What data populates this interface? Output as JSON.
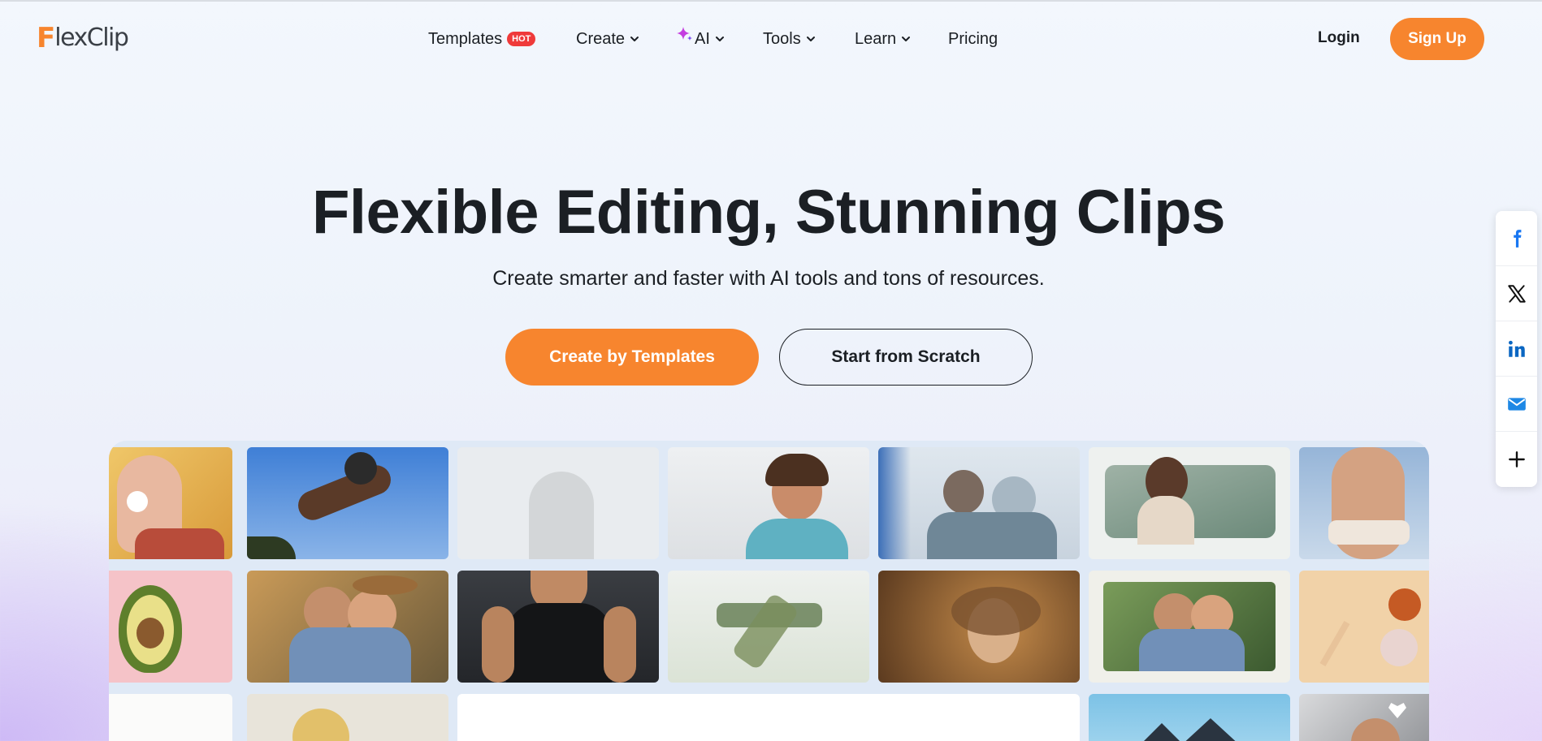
{
  "brand": {
    "logo_text": "FlexClip",
    "logo_initial": "F",
    "logo_rest": "lexClip",
    "accent": "#f7852e"
  },
  "nav": {
    "templates": {
      "label": "Templates",
      "badge": "HOT"
    },
    "create": "Create",
    "ai": "AI",
    "tools": "Tools",
    "learn": "Learn",
    "pricing": "Pricing"
  },
  "auth": {
    "login": "Login",
    "signup": "Sign Up"
  },
  "hero": {
    "title": "Flexible Editing, Stunning Clips",
    "subtitle": "Create smarter and faster with AI tools and tons of resources.",
    "primary_cta": "Create by Templates",
    "secondary_cta": "Start from Scratch"
  },
  "share": {
    "icons": [
      "facebook-icon",
      "x-icon",
      "linkedin-icon",
      "email-icon",
      "plus-icon"
    ]
  },
  "collage": {
    "tiles": [
      "woman-with-flower",
      "skateboard-jump",
      "faded-man-snow",
      "curly-hair-man",
      "couple-in-snow",
      "woman-drinking-mountain",
      "woman-shoulder",
      "avocado",
      "couple-hug",
      "gym-man",
      "dancer-field",
      "sparkle-woman",
      "couple-hug-2",
      "cosmetics-flatlay",
      "white-tile",
      "blonde-woman",
      "white-panel",
      "house-roof",
      "man-with-heart"
    ]
  }
}
